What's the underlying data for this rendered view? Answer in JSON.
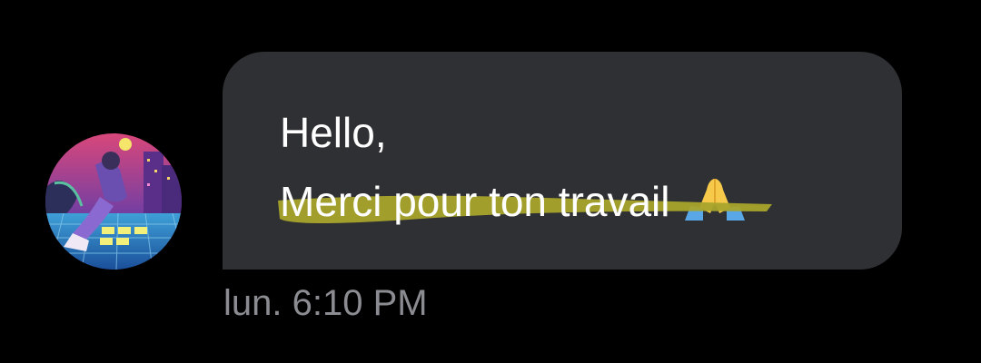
{
  "message": {
    "line1": "Hello,",
    "line2": "Merci pour ton travail",
    "reaction_emoji": "folded-hands-icon",
    "timestamp": "lun. 6:10 PM"
  },
  "colors": {
    "background": "#000000",
    "bubble": "#2f3033",
    "highlight": "#a8a42c",
    "timestamp": "#8a8c91"
  },
  "avatar": {
    "icon": "avatar-illustration"
  }
}
